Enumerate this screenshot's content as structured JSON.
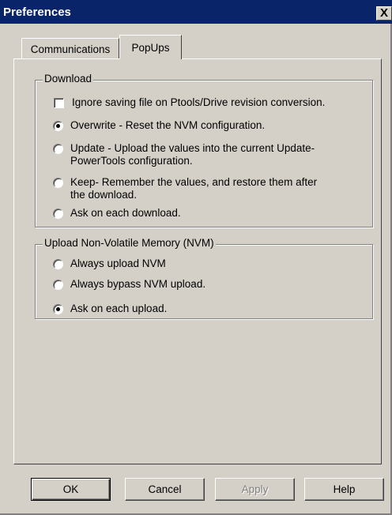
{
  "window": {
    "title": "Preferences",
    "close_glyph": "X"
  },
  "tabs": [
    {
      "label": "Communications",
      "selected": false
    },
    {
      "label": "PopUps",
      "selected": true
    }
  ],
  "download_group": {
    "label": "Download",
    "ignore_checkbox": {
      "label": "Ignore saving file on Ptools/Drive revision conversion.",
      "checked": false
    },
    "options": [
      {
        "line1": "Overwrite - Reset the NVM configuration.",
        "line2": "",
        "selected": true
      },
      {
        "line1": "Update - Upload the values into the current Update-",
        "line2": "PowerTools configuration.",
        "selected": false
      },
      {
        "line1": "Keep- Remember the values, and restore them after",
        "line2": "the download.",
        "selected": false
      },
      {
        "line1": "Ask on each download.",
        "line2": "",
        "selected": false
      }
    ]
  },
  "upload_group": {
    "label": "Upload Non-Volatile Memory (NVM)",
    "options": [
      {
        "label": "Always upload NVM",
        "selected": false
      },
      {
        "label": "Always bypass NVM upload.",
        "selected": false
      },
      {
        "label": "Ask on each upload.",
        "selected": true
      }
    ]
  },
  "buttons": {
    "ok": "OK",
    "cancel": "Cancel",
    "apply": "Apply",
    "help": "Help",
    "apply_enabled": false
  },
  "colors": {
    "titlebar": "#0a246a",
    "face": "#d4d0c8"
  }
}
